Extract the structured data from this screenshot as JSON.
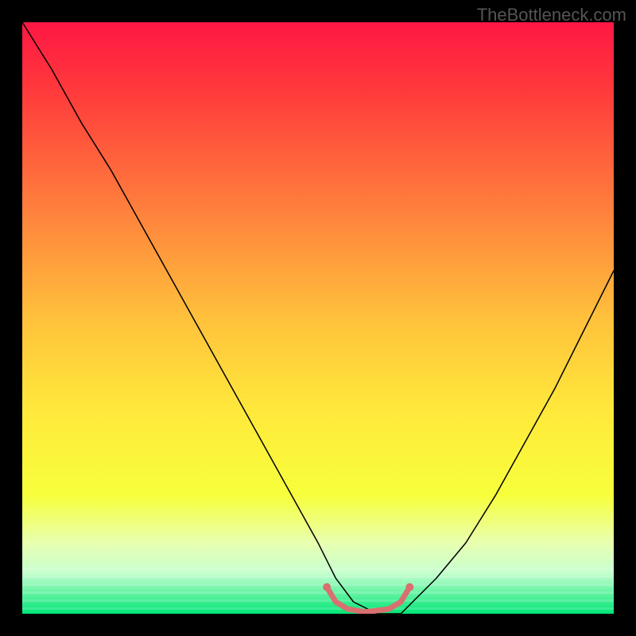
{
  "watermark": "TheBottleneck.com",
  "chart_data": {
    "type": "line",
    "title": "",
    "xlabel": "",
    "ylabel": "",
    "xlim": [
      0,
      100
    ],
    "ylim": [
      0,
      100
    ],
    "background_gradient": {
      "stops": [
        {
          "offset": 0.0,
          "color": "#ff1744"
        },
        {
          "offset": 0.12,
          "color": "#ff3b3b"
        },
        {
          "offset": 0.3,
          "color": "#ff7a3d"
        },
        {
          "offset": 0.5,
          "color": "#ffc13b"
        },
        {
          "offset": 0.66,
          "color": "#ffe93b"
        },
        {
          "offset": 0.8,
          "color": "#f7ff3b"
        },
        {
          "offset": 0.88,
          "color": "#e8ffb0"
        },
        {
          "offset": 0.93,
          "color": "#c8ffd0"
        },
        {
          "offset": 1.0,
          "color": "#00e676"
        }
      ]
    },
    "series": [
      {
        "name": "bottleneck-curve",
        "color": "#000000",
        "stroke_width": 1.5,
        "x": [
          0,
          5,
          10,
          15,
          20,
          25,
          30,
          35,
          40,
          45,
          50,
          53,
          56,
          60,
          64,
          66,
          70,
          75,
          80,
          85,
          90,
          95,
          100
        ],
        "y": [
          100,
          92,
          83,
          75,
          66,
          57,
          48,
          39,
          30,
          21,
          12,
          6,
          2,
          0,
          0,
          2,
          6,
          12,
          20,
          29,
          38,
          48,
          58
        ]
      },
      {
        "name": "optimal-highlight",
        "color": "#d87070",
        "stroke_width": 7,
        "x": [
          51.5,
          53,
          55,
          58,
          62,
          64,
          65.5
        ],
        "y": [
          4.5,
          2.0,
          0.8,
          0.3,
          0.8,
          2.0,
          4.5
        ]
      }
    ]
  }
}
